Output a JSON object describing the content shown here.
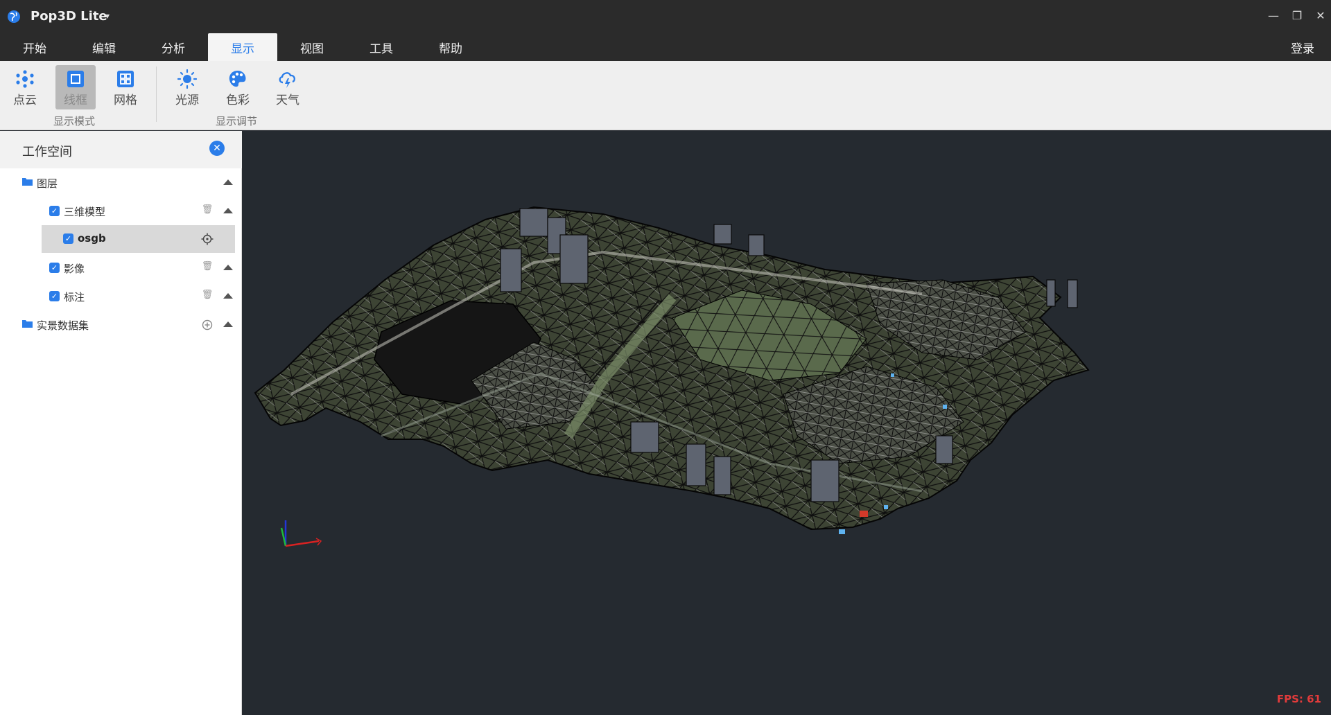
{
  "app": {
    "title": "Pop3D Lite",
    "dropdown": "▾"
  },
  "window_controls": {
    "minimize": "—",
    "restore": "❐",
    "close": "✕"
  },
  "menu": {
    "tabs": [
      "开始",
      "编辑",
      "分析",
      "显示",
      "视图",
      "工具",
      "帮助"
    ],
    "active_tab": "显示",
    "login": "登录"
  },
  "ribbon": {
    "display_mode": {
      "group_label": "显示模式",
      "buttons": [
        "点云",
        "线框",
        "网格"
      ],
      "active": "线框"
    },
    "display_adjust": {
      "group_label": "显示调节",
      "buttons": [
        "光源",
        "色彩",
        "天气"
      ]
    }
  },
  "sidebar": {
    "title": "工作空间",
    "tree": {
      "layers": "图层",
      "model3d": "三维模型",
      "osgb": "osgb",
      "imagery": "影像",
      "annotation": "标注",
      "dataset": "实景数据集"
    }
  },
  "viewport": {
    "fps_label": "FPS: 61"
  },
  "colors": {
    "accent": "#2b7de9",
    "titlebar": "#2b2b2b",
    "viewport_bg": "#252a30",
    "fps": "#e23b3b"
  }
}
